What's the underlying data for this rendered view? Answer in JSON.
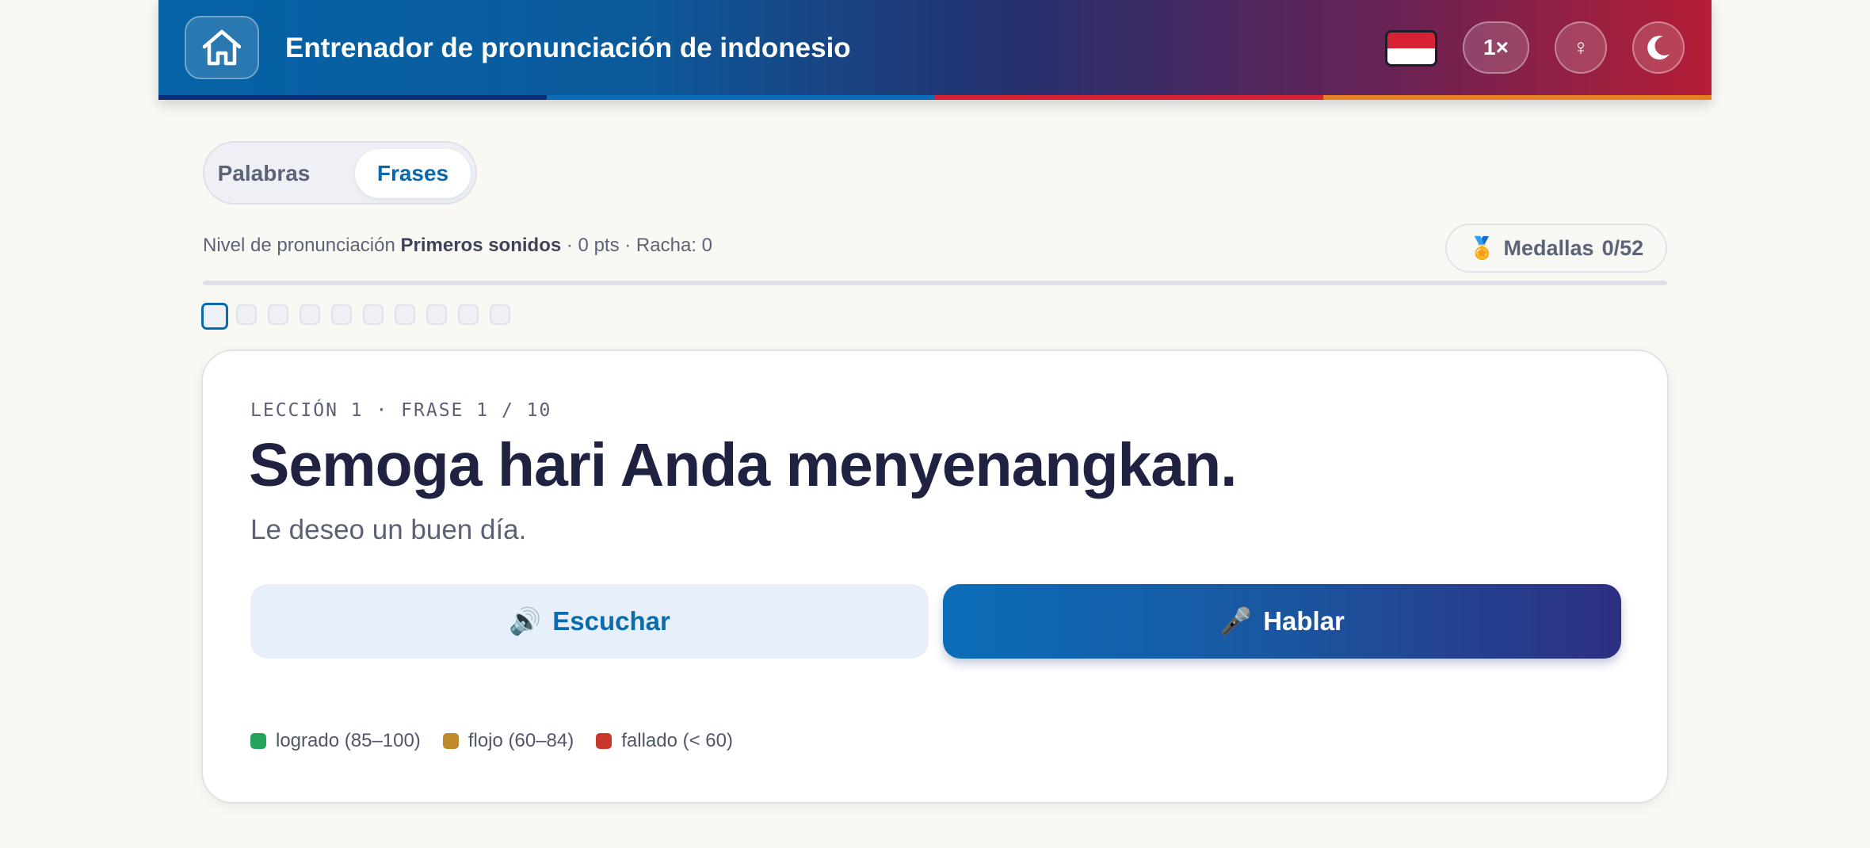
{
  "header": {
    "title": "Entrenador de pronunciación de indonesio",
    "speed_label": "1×",
    "gender_icon": "♀",
    "flag_colors": [
      "#d62232",
      "#ffffff"
    ],
    "stripe_colors": [
      "#0b2f77",
      "#0b6db8",
      "#d62232",
      "#e67e22"
    ]
  },
  "mode_toggle": {
    "words_label": "Palabras",
    "phrases_label": "Frases",
    "active": "phrases"
  },
  "status": {
    "level_prefix": "Nivel de pronunciación",
    "level_name": "Primeros sonidos",
    "suffix": "· 0 pts · Racha: 0",
    "medals_label": "Medallas",
    "medals_count": "0/52",
    "medal_icon": "🏅",
    "progress": 0
  },
  "lesson_dots": {
    "total": 10,
    "current": 1
  },
  "card": {
    "eyebrow": "LECCIÓN 1 · FRASE 1 / 10",
    "phrase": "Semoga hari Anda menyenangkan.",
    "translation": "Le deseo un buen día.",
    "listen_icon": "🔊",
    "listen_label": "Escuchar",
    "speak_icon": "🎤",
    "speak_label": "Hablar"
  },
  "legend": [
    {
      "label": "logrado (85–100)",
      "color": "#22a55a"
    },
    {
      "label": "flojo (60–84)",
      "color": "#c08a2a"
    },
    {
      "label": "fallado (< 60)",
      "color": "#c9372c"
    }
  ]
}
